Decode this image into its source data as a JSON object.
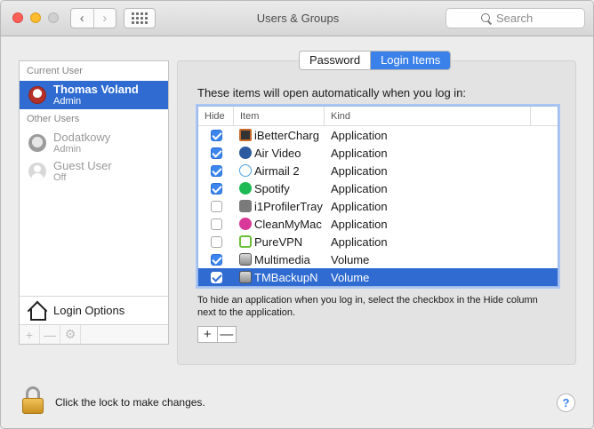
{
  "window": {
    "title": "Users & Groups"
  },
  "toolbar": {
    "back_glyph": "‹",
    "forward_glyph": "›",
    "search_placeholder": "Search"
  },
  "sidebar": {
    "current_header": "Current User",
    "current_user": {
      "name": "Thomas Voland",
      "role": "Admin"
    },
    "other_header": "Other Users",
    "others": [
      {
        "name": "Dodatkowy",
        "role": "Admin"
      },
      {
        "name": "Guest User",
        "role": "Off"
      }
    ],
    "login_options": "Login Options",
    "add_glyph": "+",
    "remove_glyph": "—"
  },
  "tabs": {
    "password": "Password",
    "login_items": "Login Items",
    "active": "Login Items"
  },
  "main": {
    "intro": "These items will open automatically when you log in:",
    "columns": {
      "hide": "Hide",
      "item": "Item",
      "kind": "Kind"
    },
    "items": [
      {
        "name": "iBetterCharg",
        "kind": "Application",
        "hide": true,
        "icon": "ibettercharge-icon"
      },
      {
        "name": "Air Video",
        "kind": "Application",
        "hide": true,
        "icon": "airvideo-icon"
      },
      {
        "name": "Airmail 2",
        "kind": "Application",
        "hide": true,
        "icon": "airmail-icon"
      },
      {
        "name": "Spotify",
        "kind": "Application",
        "hide": true,
        "icon": "spotify-icon"
      },
      {
        "name": "i1ProfilerTray",
        "kind": "Application",
        "hide": false,
        "icon": "i1profiler-icon"
      },
      {
        "name": "CleanMyMac",
        "kind": "Application",
        "hide": false,
        "icon": "cleanmymac-icon"
      },
      {
        "name": "PureVPN",
        "kind": "Application",
        "hide": false,
        "icon": "purevpn-icon"
      },
      {
        "name": "Multimedia",
        "kind": "Volume",
        "hide": true,
        "icon": "volume-icon"
      },
      {
        "name": "TMBackupN",
        "kind": "Volume",
        "hide": true,
        "icon": "volume-icon",
        "selected": true
      }
    ],
    "hint": "To hide an application when you log in, select the checkbox in the Hide column next to the application.",
    "add_glyph": "+",
    "remove_glyph": "—"
  },
  "footer": {
    "lock_text": "Click the lock to make changes.",
    "help_glyph": "?"
  }
}
